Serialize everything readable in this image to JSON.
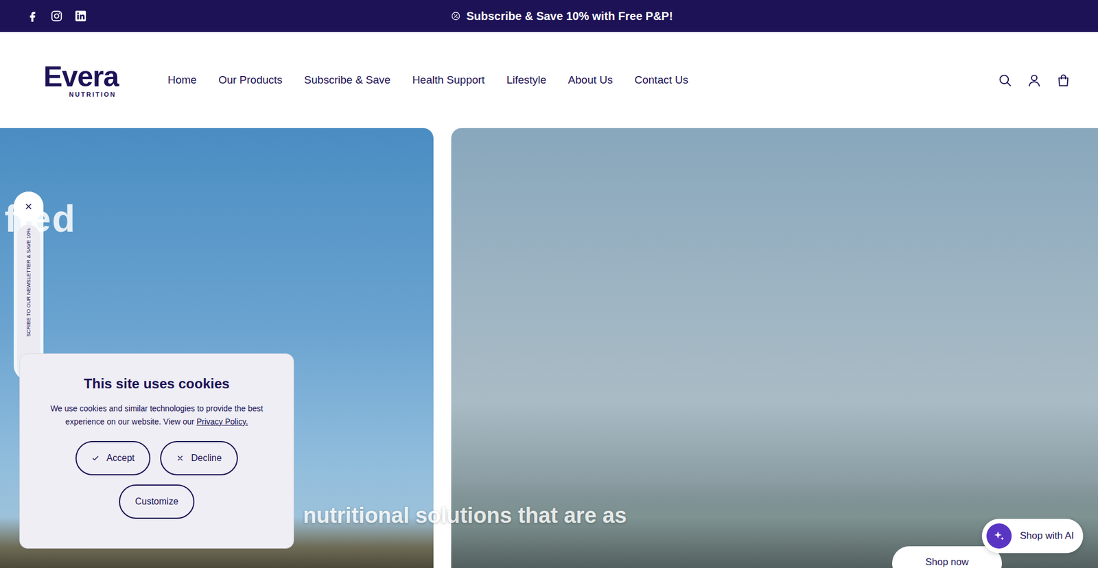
{
  "announcement": {
    "text": "Subscribe & Save 10% with Free P&P!"
  },
  "logo": {
    "name": "Evera",
    "tagline": "NUTRITION"
  },
  "nav": [
    "Home",
    "Our Products",
    "Subscribe & Save",
    "Health Support",
    "Lifestyle",
    "About Us",
    "Contact Us"
  ],
  "hero": {
    "title_fragment": "fied",
    "subtitle": "nutritional solutions that are as",
    "cta": "Shop now"
  },
  "newsletter_tab": {
    "label": "SCRIBE TO OUR NEWSLETTER & SAVE 10%"
  },
  "cookie_banner": {
    "title": "This site uses cookies",
    "text": "We use cookies and similar technologies to provide the best experience on our website. View our",
    "link": "Privacy Policy.",
    "buttons": [
      {
        "label": "Accept",
        "kind": "accept"
      },
      {
        "label": "Decline",
        "kind": "decline"
      },
      {
        "label": "Customize",
        "kind": "customize"
      }
    ]
  },
  "ai_button": {
    "label": "Shop with AI"
  }
}
